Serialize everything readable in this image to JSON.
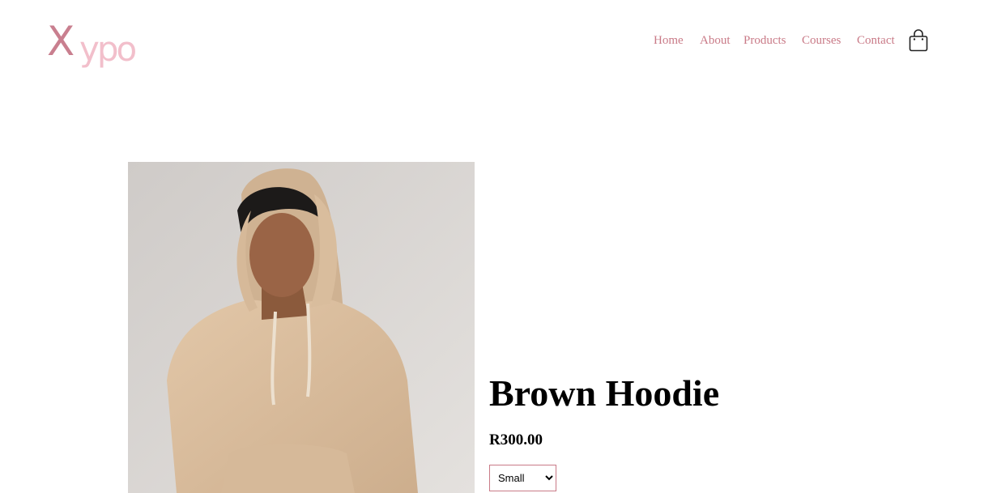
{
  "brand": {
    "logo_first": "X",
    "logo_rest": "ypo"
  },
  "nav": {
    "items": [
      {
        "label": "Home"
      },
      {
        "label": "About"
      },
      {
        "label": "Products"
      },
      {
        "label": "Courses"
      },
      {
        "label": "Contact"
      }
    ]
  },
  "icons": {
    "cart": "shopping-bag-icon"
  },
  "product": {
    "name": "Brown Hoodie",
    "price": "R300.00",
    "size": {
      "selected": "Small",
      "options": [
        "Small"
      ]
    },
    "image": "man-in-beige-hoodie"
  },
  "colors": {
    "accent": "#c97a87",
    "logo_light": "#f2bfcb",
    "text": "#000000"
  }
}
